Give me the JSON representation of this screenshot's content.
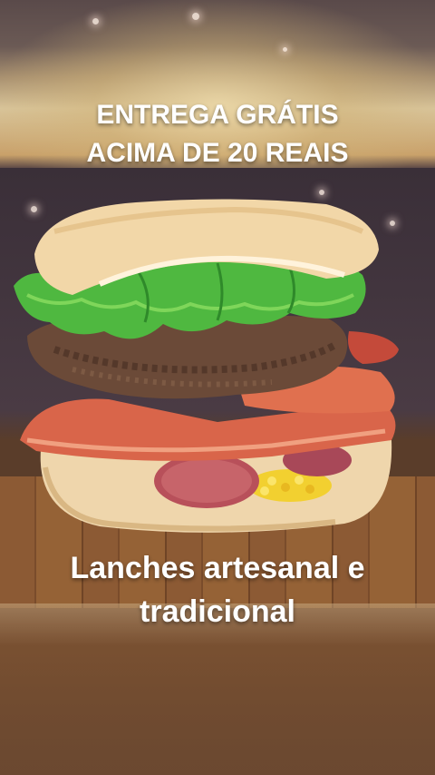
{
  "promo": {
    "line1": "ENTREGA GRÁTIS",
    "line2": "ACIMA DE 20 REAIS"
  },
  "tagline": {
    "line1": "Lanches artesanal e",
    "line2": "tradicional"
  },
  "colors": {
    "bun": "#f2d7a8",
    "lettuce": "#4fb840",
    "patty": "#6b4a38",
    "ham": "#e0704f",
    "corn": "#f2d030",
    "wood": "#8c5a34"
  }
}
